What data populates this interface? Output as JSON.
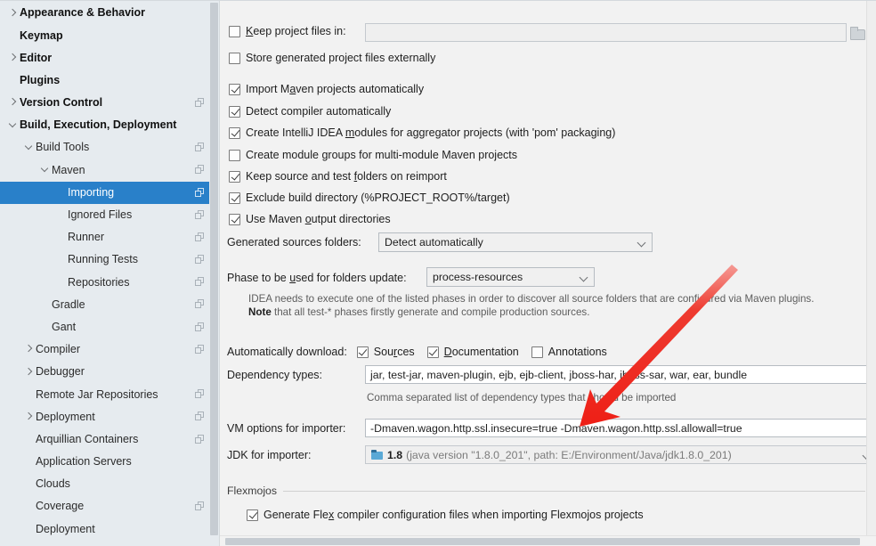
{
  "sidebar": {
    "items": [
      {
        "label": "Appearance & Behavior",
        "indent": 0,
        "twisty": "collapsed",
        "bold": true,
        "copy": false,
        "selected": false
      },
      {
        "label": "Keymap",
        "indent": 0,
        "twisty": "none",
        "bold": true,
        "copy": false,
        "selected": false
      },
      {
        "label": "Editor",
        "indent": 0,
        "twisty": "collapsed",
        "bold": true,
        "copy": false,
        "selected": false
      },
      {
        "label": "Plugins",
        "indent": 0,
        "twisty": "none",
        "bold": true,
        "copy": false,
        "selected": false
      },
      {
        "label": "Version Control",
        "indent": 0,
        "twisty": "collapsed",
        "bold": true,
        "copy": true,
        "selected": false
      },
      {
        "label": "Build, Execution, Deployment",
        "indent": 0,
        "twisty": "expanded",
        "bold": true,
        "copy": false,
        "selected": false
      },
      {
        "label": "Build Tools",
        "indent": 1,
        "twisty": "expanded",
        "bold": false,
        "copy": true,
        "selected": false
      },
      {
        "label": "Maven",
        "indent": 2,
        "twisty": "expanded",
        "bold": false,
        "copy": true,
        "selected": false
      },
      {
        "label": "Importing",
        "indent": 3,
        "twisty": "none",
        "bold": false,
        "copy": true,
        "selected": true
      },
      {
        "label": "Ignored Files",
        "indent": 3,
        "twisty": "none",
        "bold": false,
        "copy": true,
        "selected": false
      },
      {
        "label": "Runner",
        "indent": 3,
        "twisty": "none",
        "bold": false,
        "copy": true,
        "selected": false
      },
      {
        "label": "Running Tests",
        "indent": 3,
        "twisty": "none",
        "bold": false,
        "copy": true,
        "selected": false
      },
      {
        "label": "Repositories",
        "indent": 3,
        "twisty": "none",
        "bold": false,
        "copy": true,
        "selected": false
      },
      {
        "label": "Gradle",
        "indent": 2,
        "twisty": "none",
        "bold": false,
        "copy": true,
        "selected": false
      },
      {
        "label": "Gant",
        "indent": 2,
        "twisty": "none",
        "bold": false,
        "copy": true,
        "selected": false
      },
      {
        "label": "Compiler",
        "indent": 1,
        "twisty": "collapsed",
        "bold": false,
        "copy": true,
        "selected": false
      },
      {
        "label": "Debugger",
        "indent": 1,
        "twisty": "collapsed",
        "bold": false,
        "copy": false,
        "selected": false
      },
      {
        "label": "Remote Jar Repositories",
        "indent": 1,
        "twisty": "none",
        "bold": false,
        "copy": true,
        "selected": false
      },
      {
        "label": "Deployment",
        "indent": 1,
        "twisty": "collapsed",
        "bold": false,
        "copy": true,
        "selected": false
      },
      {
        "label": "Arquillian Containers",
        "indent": 1,
        "twisty": "none",
        "bold": false,
        "copy": true,
        "selected": false
      },
      {
        "label": "Application Servers",
        "indent": 1,
        "twisty": "none",
        "bold": false,
        "copy": false,
        "selected": false
      },
      {
        "label": "Clouds",
        "indent": 1,
        "twisty": "none",
        "bold": false,
        "copy": false,
        "selected": false
      },
      {
        "label": "Coverage",
        "indent": 1,
        "twisty": "none",
        "bold": false,
        "copy": true,
        "selected": false
      },
      {
        "label": "Deployment",
        "indent": 1,
        "twisty": "none",
        "bold": false,
        "copy": false,
        "selected": false
      }
    ]
  },
  "main": {
    "keep_project_files": {
      "label_pre": "",
      "label_mn": "K",
      "label_post": "eep project files in:",
      "checked": false,
      "value": "",
      "browse_icon": "folder-icon"
    },
    "store_generated": {
      "label_pre": "Store ",
      "label_mn": "g",
      "label_post": "enerated project files externally",
      "checked": false
    },
    "checkboxes": [
      {
        "pre": "Import M",
        "mn": "a",
        "post": "ven projects automatically",
        "checked": true
      },
      {
        "pre": "Detect compiler automatically",
        "mn": "",
        "post": "",
        "checked": true
      },
      {
        "pre": "Create IntelliJ IDEA ",
        "mn": "m",
        "post": "odules for aggregator projects (with 'pom' packaging)",
        "checked": true
      },
      {
        "pre": "Create module ",
        "mn": "g",
        "post": "roups for multi-module Maven projects",
        "checked": false
      },
      {
        "pre": "Keep source and test ",
        "mn": "f",
        "post": "olders on reimport",
        "checked": true
      },
      {
        "pre": "Exclude build directory (%PROJECT_ROOT%/target)",
        "mn": "",
        "post": "",
        "checked": true
      },
      {
        "pre": "Use Maven ",
        "mn": "o",
        "post": "utput directories",
        "checked": true
      }
    ],
    "generated_sources": {
      "label": "Generated sources folders:",
      "value": "Detect automatically"
    },
    "phase": {
      "label_pre": "Phase to be ",
      "label_mn": "u",
      "label_post": "sed for folders update:",
      "value": "process-resources"
    },
    "note_line1": "IDEA needs to execute one of the listed phases in order to discover all source folders that are configured via Maven plugins.",
    "note_bold": "Note",
    "note_line2": " that all test-* phases firstly generate and compile production sources.",
    "auto_download": {
      "label": "Automatically download:",
      "options": [
        {
          "pre": "Sou",
          "mn": "r",
          "post": "ces",
          "checked": true
        },
        {
          "pre": "",
          "mn": "D",
          "post": "ocumentation",
          "checked": true
        },
        {
          "pre": "Annotations",
          "mn": "",
          "post": "",
          "checked": false
        }
      ]
    },
    "dependency_types": {
      "label": "Dependency types:",
      "value": "jar, test-jar, maven-plugin, ejb, ejb-client, jboss-har, jboss-sar, war, ear, bundle",
      "hint": "Comma separated list of dependency types that should be imported"
    },
    "vm_options": {
      "label": "VM options for importer:",
      "value": "-Dmaven.wagon.http.ssl.insecure=true -Dmaven.wagon.http.ssl.allowall=true"
    },
    "jdk_importer": {
      "label": "JDK for importer:",
      "icon": "jdk-icon",
      "version": "1.8",
      "path": "(java version \"1.8.0_201\", path: E:/Environment/Java/jdk1.8.0_201)"
    },
    "flexmojos": {
      "group_title": "Flexmojos",
      "checkbox": {
        "pre": "Generate Fle",
        "mn": "x",
        "post": " compiler configuration files when importing Flexmojos projects",
        "checked": true
      }
    }
  },
  "annotation": {
    "arrow_color": "#ee2222"
  }
}
